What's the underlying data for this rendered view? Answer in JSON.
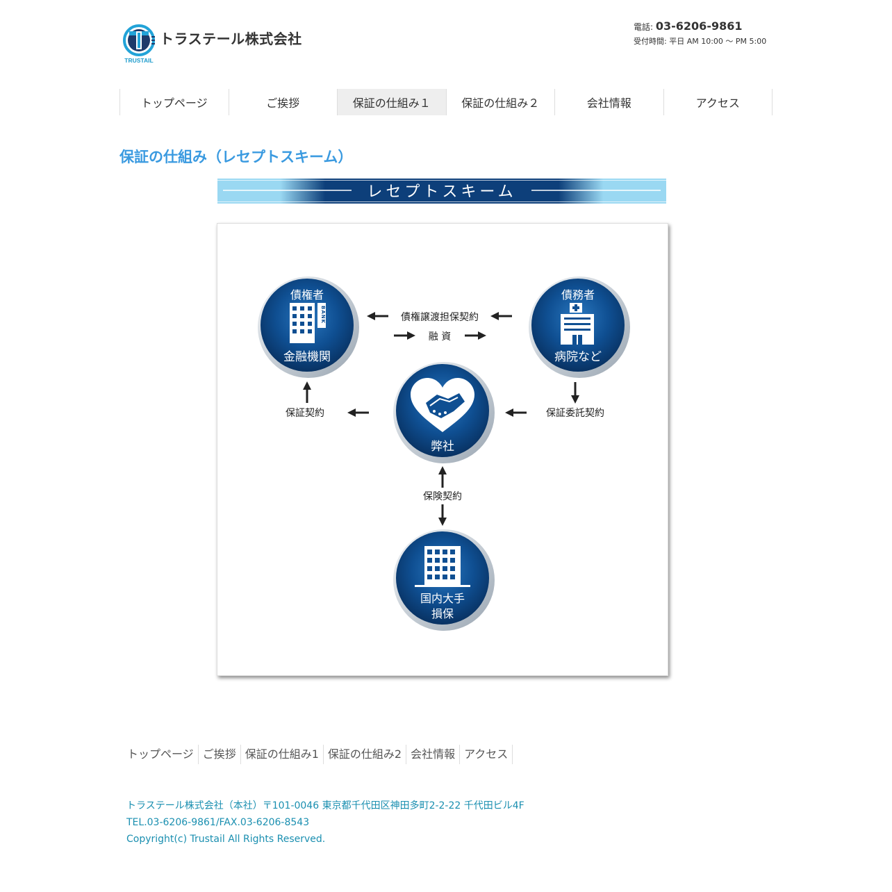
{
  "header": {
    "logo_text": "TRUSTAIL",
    "company_name": "トラステール株式会社",
    "tel_label": "電話:",
    "tel_number": "03-6206-9861",
    "hours": "受付時間: 平日 AM 10:00 〜 PM 5:00"
  },
  "nav": {
    "items": [
      {
        "label": "トップページ"
      },
      {
        "label": "ご挨拶"
      },
      {
        "label": "保証の仕組み１"
      },
      {
        "label": "保証の仕組み２"
      },
      {
        "label": "会社情報"
      },
      {
        "label": "アクセス"
      }
    ],
    "active_index": 2
  },
  "page_title": "保証の仕組み（レセプトスキーム）",
  "banner_title": "レセプトスキーム",
  "diagram": {
    "creditor_top": "債権者",
    "creditor_bottom": "金融機関",
    "bank_text": "BANK",
    "debtor_top": "債務者",
    "debtor_bottom": "病院など",
    "company": "弊社",
    "insurer_line1": "国内大手",
    "insurer_line2": "損保",
    "arrow_assignment": "債権譲渡担保契約",
    "arrow_financing": "融 資",
    "arrow_guarantee": "保証契約",
    "arrow_guarantee_consign": "保証委託契約",
    "arrow_insurance": "保険契約"
  },
  "footer_nav": {
    "items": [
      {
        "label": "トップページ"
      },
      {
        "label": "ご挨拶"
      },
      {
        "label": "保証の仕組み1"
      },
      {
        "label": "保証の仕組み2"
      },
      {
        "label": "会社情報"
      },
      {
        "label": "アクセス"
      }
    ]
  },
  "footer": {
    "address": "トラステール株式会社（本社）〒101-0046 東京都千代田区神田多町2-2-22 千代田ビル4F",
    "telfax": "TEL.03-6206-9861/FAX.03-6206-8543",
    "copyright": "Copyright(c) Trustail All Rights Reserved."
  },
  "colors": {
    "accent": "#3a9ae0",
    "navy": "#0d3f7a",
    "footer_text": "#1a8fb0",
    "banner_light": "#9ad8f2"
  }
}
